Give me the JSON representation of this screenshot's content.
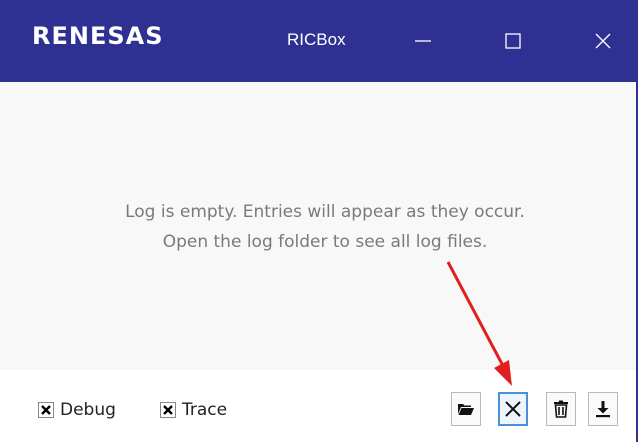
{
  "window": {
    "brand": "RENESAS",
    "title": "RICBox",
    "controls": [
      "minimize-icon",
      "maximize-icon",
      "close-icon"
    ]
  },
  "log": {
    "empty_line1": "Log is empty. Entries will appear as they occur.",
    "empty_line2": "Open the log folder to see all log files."
  },
  "footer": {
    "checkboxes": [
      {
        "label": "Debug",
        "checked": true
      },
      {
        "label": "Trace",
        "checked": true
      }
    ],
    "tools": [
      "folder-open-icon",
      "clear-icon",
      "trash-icon",
      "download-icon"
    ]
  },
  "colors": {
    "titlebar": "#2e3192",
    "annotation_arrow": "#e02020",
    "empty_text": "#7a7a7a"
  }
}
